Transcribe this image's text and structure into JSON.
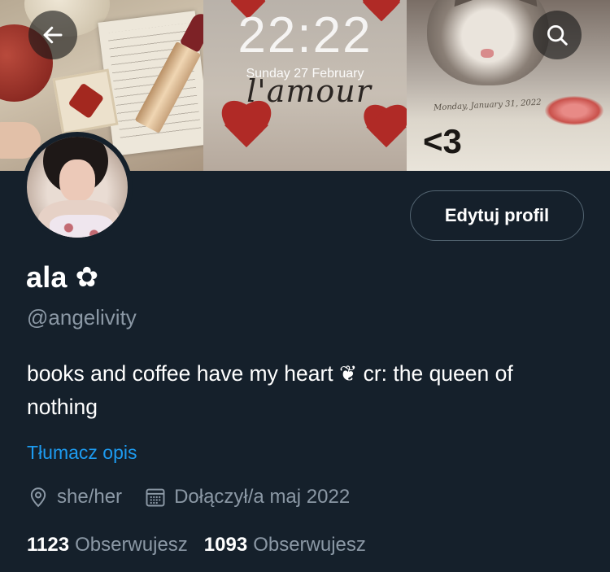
{
  "banner": {
    "lock_time": "22:22",
    "lock_date": "Sunday 27 February",
    "lamour_text": "l'amour",
    "note_text": "Monday, January 31, 2022",
    "note_heart": "<3",
    "back_icon": "arrow-left-icon",
    "search_icon": "search-icon"
  },
  "profile": {
    "display_name": "ala",
    "name_emoji": "✿",
    "handle": "@angelivity",
    "edit_label": "Edytuj profil",
    "bio": "books and coffee have my heart ❦ cr: the queen of nothing",
    "translate_label": "Tłumacz opis",
    "pronouns": "she/her",
    "joined": "Dołączył/a maj 2022",
    "following_count": "1123",
    "following_label": "Obserwujesz",
    "followers_count": "1093",
    "followers_label": "Obserwujesz"
  },
  "colors": {
    "background": "#15202b",
    "secondary_text": "#8b98a5",
    "accent": "#1d9bf0",
    "button_border": "#536471"
  }
}
